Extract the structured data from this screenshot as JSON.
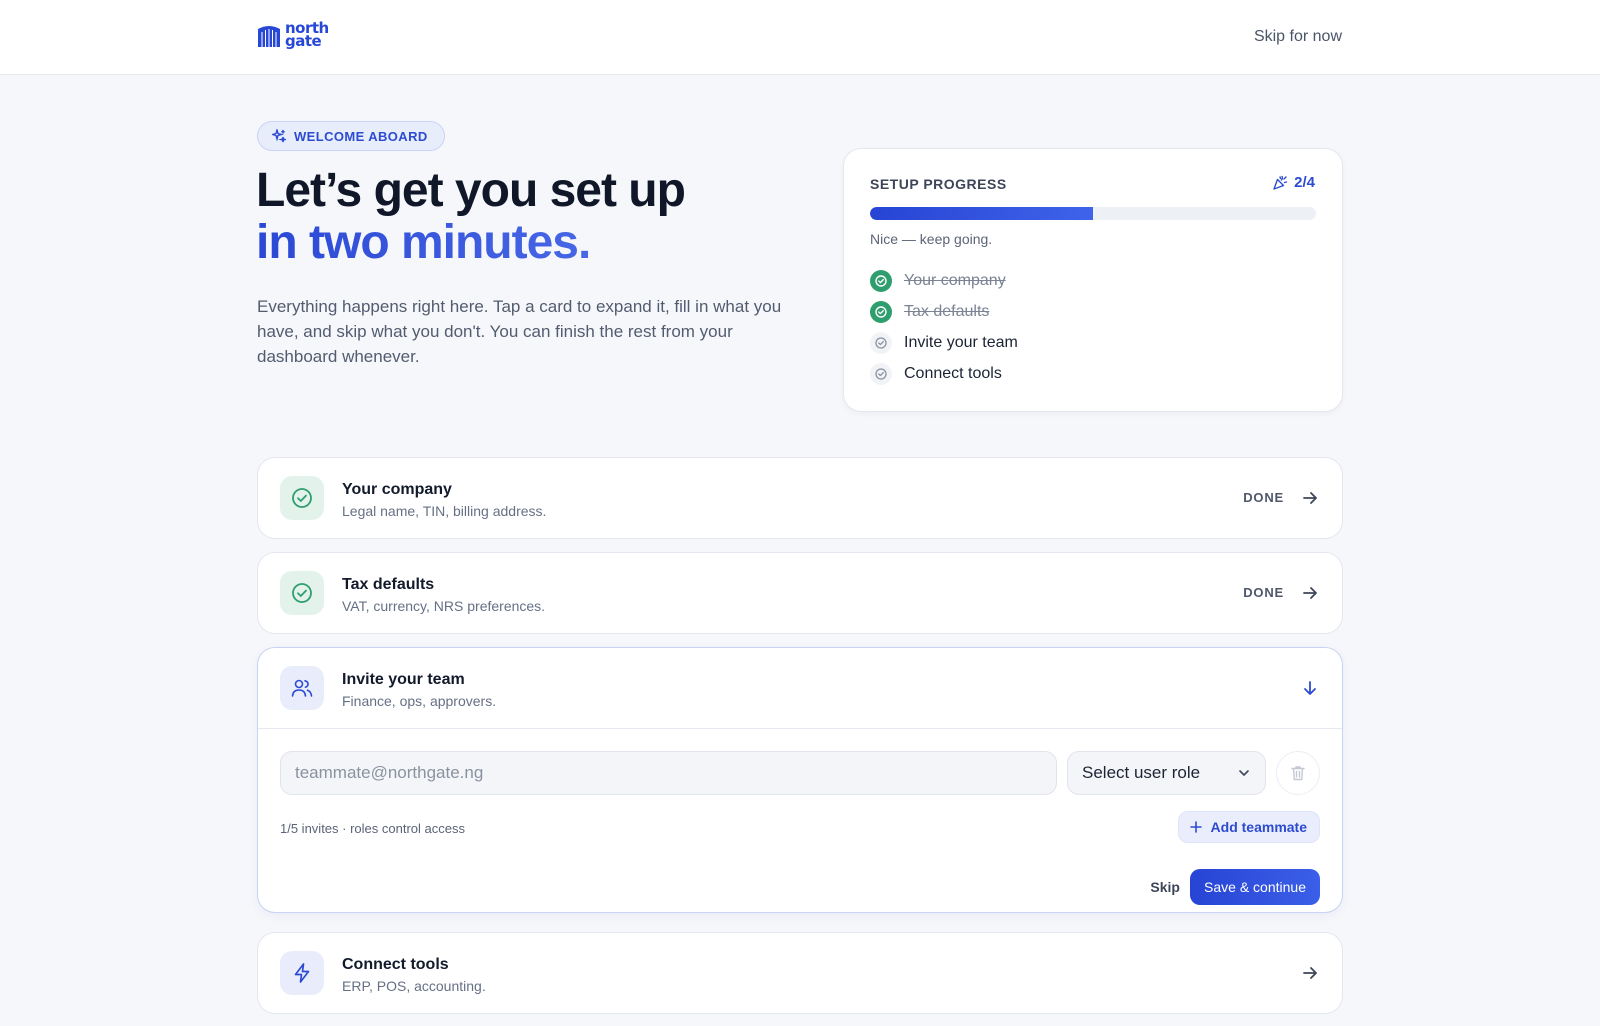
{
  "header": {
    "logo_line1": "north",
    "logo_line2": "gate",
    "skip_label": "Skip for now"
  },
  "hero": {
    "badge": "WELCOME ABOARD",
    "title_line1": "Let’s get you set up",
    "title_line2": "in two minutes.",
    "subtitle": "Everything happens right here. Tap a card to expand it, fill in what you have, and skip what you don't. You can finish the rest from your dashboard whenever."
  },
  "progress": {
    "label": "SETUP PROGRESS",
    "count": "2/4",
    "fraction": 0.5,
    "hint": "Nice — keep going.",
    "items": [
      {
        "label": "Your company",
        "done": true
      },
      {
        "label": "Tax defaults",
        "done": true
      },
      {
        "label": "Invite your team",
        "done": false
      },
      {
        "label": "Connect tools",
        "done": false
      }
    ]
  },
  "steps": [
    {
      "title": "Your company",
      "desc": "Legal name, TIN, billing address.",
      "status": "DONE"
    },
    {
      "title": "Tax defaults",
      "desc": "VAT, currency, NRS preferences.",
      "status": "DONE"
    },
    {
      "title": "Invite your team",
      "desc": "Finance, ops, approvers."
    },
    {
      "title": "Connect tools",
      "desc": "ERP, POS, accounting."
    }
  ],
  "invite": {
    "email_placeholder": "teammate@northgate.ng",
    "email_value": "",
    "role_selected": "Select user role",
    "note": "1/5 invites · roles control access",
    "add_label": "Add teammate",
    "skip_label": "Skip",
    "save_label": "Save & continue"
  },
  "colors": {
    "brand": "#2747d6",
    "success": "#2f9e6e",
    "background": "#f6f7fa"
  },
  "icons": {
    "logo": "northgate-logo-icon",
    "badge": "sparkle-icon",
    "count": "party-popper-icon",
    "done": "check-circle-icon",
    "team": "users-icon",
    "tools": "lightning-icon"
  }
}
